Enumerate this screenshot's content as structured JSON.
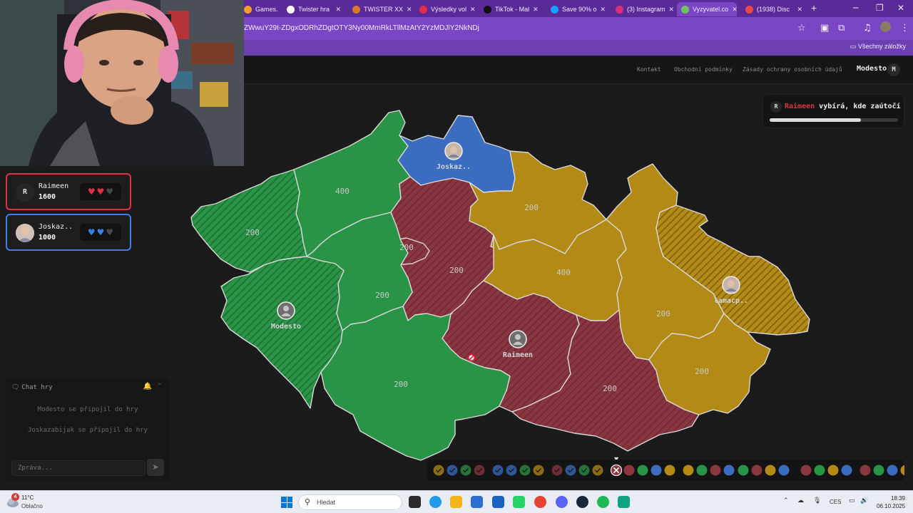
{
  "browser": {
    "tabs": [
      {
        "label": "Games.",
        "color": "#f0a030",
        "active": false
      },
      {
        "label": "Twister hra",
        "color": "#ffffff",
        "active": false
      },
      {
        "label": "TWISTER XX",
        "color": "#d97a2b",
        "active": false
      },
      {
        "label": "Výsledky vol",
        "color": "#e0304a",
        "active": false
      },
      {
        "label": "TikTok - Mal",
        "color": "#111111",
        "active": false
      },
      {
        "label": "Save 90% o",
        "color": "#1a9fff",
        "active": false
      },
      {
        "label": "(3) Instagram",
        "color": "#d6307a",
        "active": false
      },
      {
        "label": "Vyzyvatel.co",
        "color": "#6fc25a",
        "active": true
      },
      {
        "label": "(1938) Disc",
        "color": "#e5484d",
        "active": false
      }
    ],
    "url": "ZWwuY29t-ZDgxODRhZDgtOTY3Ny00MmRkLTllMzAtY2YzMDJlY2NkNDj",
    "bookmarks_all": "Všechny záložky"
  },
  "header": {
    "links": [
      "Kontakt",
      "Obchodní podmínky",
      "Zásady ochrany osobních údajů"
    ],
    "user_name": "Modesto",
    "user_initial": "M"
  },
  "players": [
    {
      "initial": "R",
      "name": "Raimeen",
      "score": "1600",
      "color": "#e0304a",
      "hearts_full": 2,
      "hearts_total": 3
    },
    {
      "initial": "",
      "name": "Joskaz..",
      "score": "1000",
      "color": "#3a7ff0",
      "hearts_full": 2,
      "hearts_total": 3
    }
  ],
  "status": {
    "initial": "R",
    "player": "Raimeen",
    "message": " vybírá, kde zaútočí",
    "progress": 0.71
  },
  "map": {
    "colors": {
      "green": "#2a9446",
      "red": "#8a3640",
      "blue": "#3a6cc0",
      "yellow": "#b38a16"
    },
    "regions": [
      {
        "owner": "green",
        "hatched": false,
        "value": "400"
      },
      {
        "owner": "green",
        "hatched": true,
        "value": "200"
      },
      {
        "owner": "blue",
        "hatched": false,
        "value": ""
      },
      {
        "owner": "yellow",
        "hatched": false,
        "value": "200"
      },
      {
        "owner": "red",
        "hatched": true,
        "value": "200"
      },
      {
        "owner": "red",
        "hatched": true,
        "value": "200"
      },
      {
        "owner": "green",
        "hatched": false,
        "value": "200"
      },
      {
        "owner": "yellow",
        "hatched": false,
        "value": "400"
      },
      {
        "owner": "yellow",
        "hatched": false,
        "value": "200"
      },
      {
        "owner": "yellow",
        "hatched": true,
        "value": ""
      },
      {
        "owner": "green",
        "hatched": true,
        "value": ""
      },
      {
        "owner": "red",
        "hatched": true,
        "value": ""
      },
      {
        "owner": "green",
        "hatched": false,
        "value": "200"
      },
      {
        "owner": "red",
        "hatched": true,
        "value": "200"
      },
      {
        "owner": "yellow",
        "hatched": false,
        "value": "200"
      }
    ],
    "capitals": [
      {
        "name": "Joskaz..",
        "avatar": "photo"
      },
      {
        "name": "lamacp..",
        "avatar": "photo"
      },
      {
        "name": "Modesto",
        "avatar": "generic"
      },
      {
        "name": "Raimeen",
        "avatar": "generic"
      }
    ]
  },
  "chat": {
    "title": "Chat hry",
    "messages": [
      "Modesto se připojil do hry",
      "Joskazabijak se připojil do hry"
    ],
    "placeholder": "Zpráva..."
  },
  "rounds": {
    "done": [
      [
        "yellow",
        "blue",
        "green",
        "red"
      ],
      [
        "blue",
        "blue",
        "green",
        "yellow"
      ],
      [
        "red",
        "blue",
        "green",
        "yellow"
      ]
    ],
    "upcoming": [
      [
        "red",
        "green",
        "blue",
        "yellow"
      ],
      [
        "yellow",
        "green",
        "red",
        "blue"
      ],
      [
        "green",
        "red",
        "yellow",
        "blue"
      ],
      [
        "red",
        "green",
        "yellow",
        "blue"
      ],
      [
        "red",
        "green",
        "blue",
        "yellow"
      ]
    ]
  },
  "taskbar": {
    "weather_badge": "4",
    "temp": "11°C",
    "weather": "Oblačno",
    "search_placeholder": "Hledat",
    "lang": "CES",
    "time": "18:39",
    "date": "06.10.2025"
  }
}
